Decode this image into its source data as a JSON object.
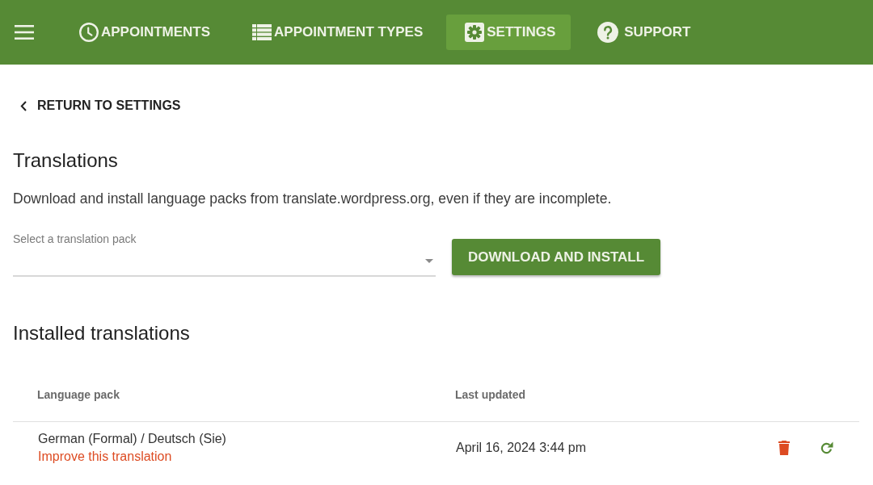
{
  "header": {
    "nav": [
      {
        "kind": "clock",
        "label": "APPOINTMENTS",
        "selected": false
      },
      {
        "kind": "table",
        "label": "APPOINTMENT TYPES",
        "selected": false
      },
      {
        "kind": "gear",
        "label": "SETTINGS",
        "selected": true
      },
      {
        "kind": "help",
        "label": "SUPPORT",
        "selected": false
      }
    ]
  },
  "back_link": "RETURN TO SETTINGS",
  "translations": {
    "title": "Translations",
    "description": "Download and install language packs from translate.wordpress.org, even if they are incomplete.",
    "select": {
      "label": "Select a translation pack"
    },
    "button": "DOWNLOAD AND INSTALL"
  },
  "installed": {
    "title": "Installed translations",
    "table": {
      "columns": [
        "Language pack",
        "Last updated"
      ],
      "rows": [
        {
          "language_pack": "German (Formal) / Deutsch (Sie)",
          "link": "Improve this translation",
          "last_updated": "April 16, 2024 3:44 pm"
        }
      ]
    }
  }
}
